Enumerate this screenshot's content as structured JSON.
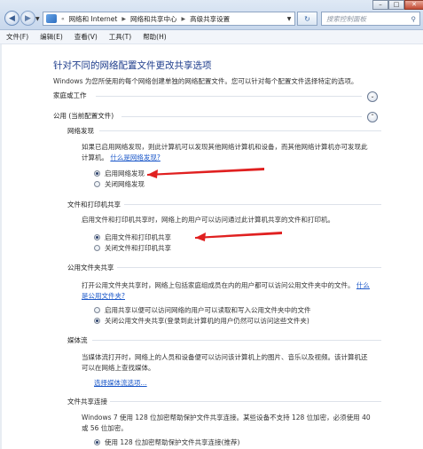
{
  "window": {
    "address_segments": [
      "网络和 Internet",
      "网络和共享中心",
      "高级共享设置"
    ],
    "search_placeholder": "搜索控制面板",
    "minimize_glyph": "–",
    "maximize_glyph": "□",
    "close_glyph": "✕"
  },
  "menu": [
    "文件(F)",
    "编辑(E)",
    "查看(V)",
    "工具(T)",
    "帮助(H)"
  ],
  "page": {
    "title": "针对不同的网络配置文件更改共享选项",
    "description": "Windows 为您所使用的每个网络创建单独的网络配置文件。您可以针对每个配置文件选择特定的选项。",
    "profiles": [
      {
        "label": "家庭或工作",
        "expanded": false
      },
      {
        "label": "公用 (当前配置文件)",
        "expanded": true
      }
    ]
  },
  "sections": {
    "discovery": {
      "heading": "网络发现",
      "text_line1": "如果已启用网络发现，则此计算机可以发现其他网络计算机和设备，而其他网络计算机亦可发现此",
      "text_line2": "计算机。",
      "link": "什么是网络发现?",
      "options": [
        {
          "label": "启用网络发现",
          "selected": true
        },
        {
          "label": "关闭网络发现",
          "selected": false
        }
      ]
    },
    "file_printer": {
      "heading": "文件和打印机共享",
      "text": "启用文件和打印机共享时，网络上的用户可以访问通过此计算机共享的文件和打印机。",
      "options": [
        {
          "label": "启用文件和打印机共享",
          "selected": true
        },
        {
          "label": "关闭文件和打印机共享",
          "selected": false
        }
      ]
    },
    "public_folder": {
      "heading": "公用文件夹共享",
      "text_line1": "打开公用文件夹共享时，网络上包括家庭组成员在内的用户都可以访问公用文件夹中的文件。",
      "link_part1": "什么",
      "link_part2": "是公用文件夹?",
      "options": [
        {
          "label": "启用共享以便可以访问网络的用户可以读取和写入公用文件夹中的文件",
          "selected": false
        },
        {
          "label": "关闭公用文件夹共享(登录到此计算机的用户仍然可以访问这些文件夹)",
          "selected": true
        }
      ]
    },
    "media": {
      "heading": "媒体流",
      "text_line1": "当媒体流打开时，网络上的人员和设备便可以访问该计算机上的图片、音乐以及视频。该计算机还",
      "text_line2": "可以在网络上查找媒体。",
      "link": "选择媒体流选项..."
    },
    "connections": {
      "heading": "文件共享连接",
      "text_line1": "Windows 7 使用 128 位加密帮助保护文件共享连接。某些设备不支持 128 位加密，必须使用 40",
      "text_line2": "或 56 位加密。",
      "options": [
        {
          "label": "使用 128 位加密帮助保护文件共享连接(推荐)",
          "selected": true
        }
      ]
    }
  },
  "colors": {
    "title": "#1e3d8c",
    "link": "#1a57c9",
    "annotation_arrow": "#e02020"
  }
}
